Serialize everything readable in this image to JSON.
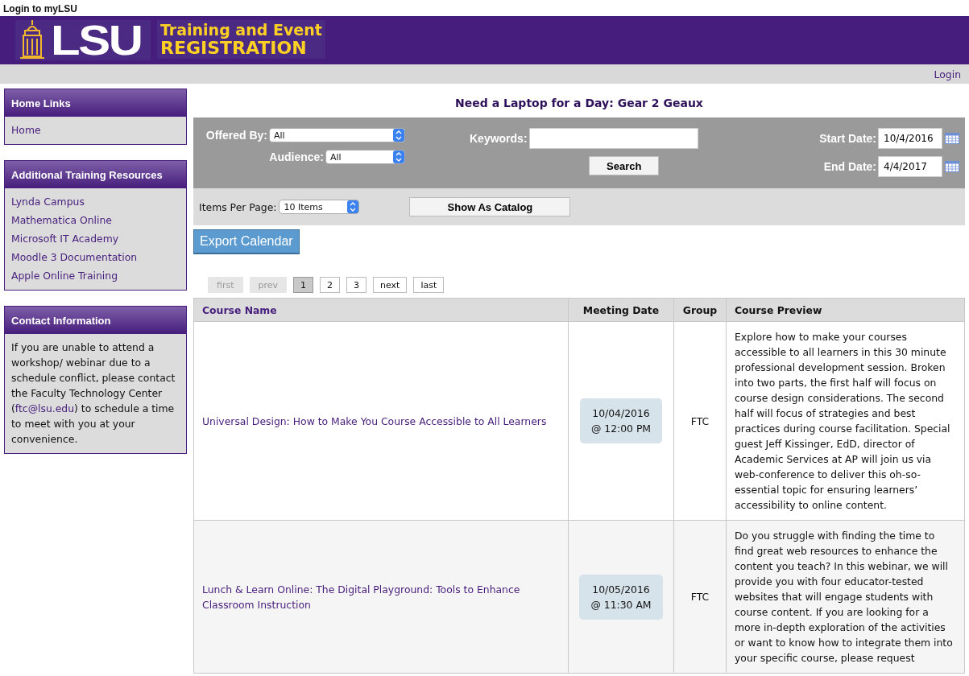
{
  "top_link": "Login to myLSU",
  "logo": {
    "wordmark": "LSU",
    "line1": "Training and Event",
    "line2": "REGISTRATION"
  },
  "login": "Login",
  "sidebar": [
    {
      "title": "Home Links",
      "kind": "links",
      "items": [
        "Home"
      ]
    },
    {
      "title": "Additional Training Resources",
      "kind": "links",
      "items": [
        "Lynda Campus",
        "Mathematica Online",
        "Microsoft IT Academy",
        "Moodle 3 Documentation",
        "Apple Online Training"
      ]
    },
    {
      "title": "Contact Information",
      "kind": "text",
      "before": "If you are unable to attend a workshop/ webinar due to a schedule conflict, please contact the Faculty Technology Center (",
      "link": "ftc@lsu.edu",
      "after": ") to schedule a time to meet with you at your convenience."
    }
  ],
  "page_title": "Need a Laptop for a Day: Gear 2 Geaux",
  "filters": {
    "offered_by": {
      "label": "Offered By:",
      "value": "All"
    },
    "audience": {
      "label": "Audience:",
      "value": "All"
    },
    "keywords": {
      "label": "Keywords:"
    },
    "search": "Search",
    "start_date": {
      "label": "Start Date:",
      "value": "10/4/2016"
    },
    "end_date": {
      "label": "End Date:",
      "value": "4/4/2017"
    }
  },
  "items_per_page": {
    "label": "Items Per Page:",
    "value": "10 Items"
  },
  "show_catalog": "Show As Catalog",
  "export": "Export Calendar",
  "pager": [
    {
      "label": "first",
      "disabled": true,
      "selected": false
    },
    {
      "label": "prev",
      "disabled": true,
      "selected": false
    },
    {
      "label": "1",
      "disabled": false,
      "selected": true
    },
    {
      "label": "2",
      "disabled": false,
      "selected": false
    },
    {
      "label": "3",
      "disabled": false,
      "selected": false
    },
    {
      "label": "next",
      "disabled": false,
      "selected": false
    },
    {
      "label": "last",
      "disabled": false,
      "selected": false
    }
  ],
  "table": {
    "columns": [
      "Course Name",
      "Meeting Date",
      "Group",
      "Course Preview"
    ],
    "rows": [
      {
        "name": "Universal Design: How to Make You Course Accessible to All Learners",
        "date": "10/04/2016",
        "time": "@ 12:00 PM",
        "group": "FTC",
        "preview": "Explore how to make your courses accessible to all learners in this 30 minute professional development session. Broken into two parts, the first half will focus on course design considerations. The second half will focus of strategies and best practices during course facilitation. Special guest Jeff Kissinger, EdD, director of Academic Services at AP will join us via web-conference to deliver this oh-so-essential topic for ensuring learners’ accessibility to online content."
      },
      {
        "name": "Lunch & Learn Online: The Digital Playground: Tools to Enhance Classroom Instruction",
        "date": "10/05/2016",
        "time": "@ 11:30 AM",
        "group": "FTC",
        "preview": "Do you struggle with finding the time to find great web resources to enhance the content you teach? In this webinar, we will provide you with four educator-tested websites that will engage students with course content. If you are looking for a more in-depth exploration of the activities or want to know how to integrate them into your specific course, please request"
      }
    ]
  }
}
